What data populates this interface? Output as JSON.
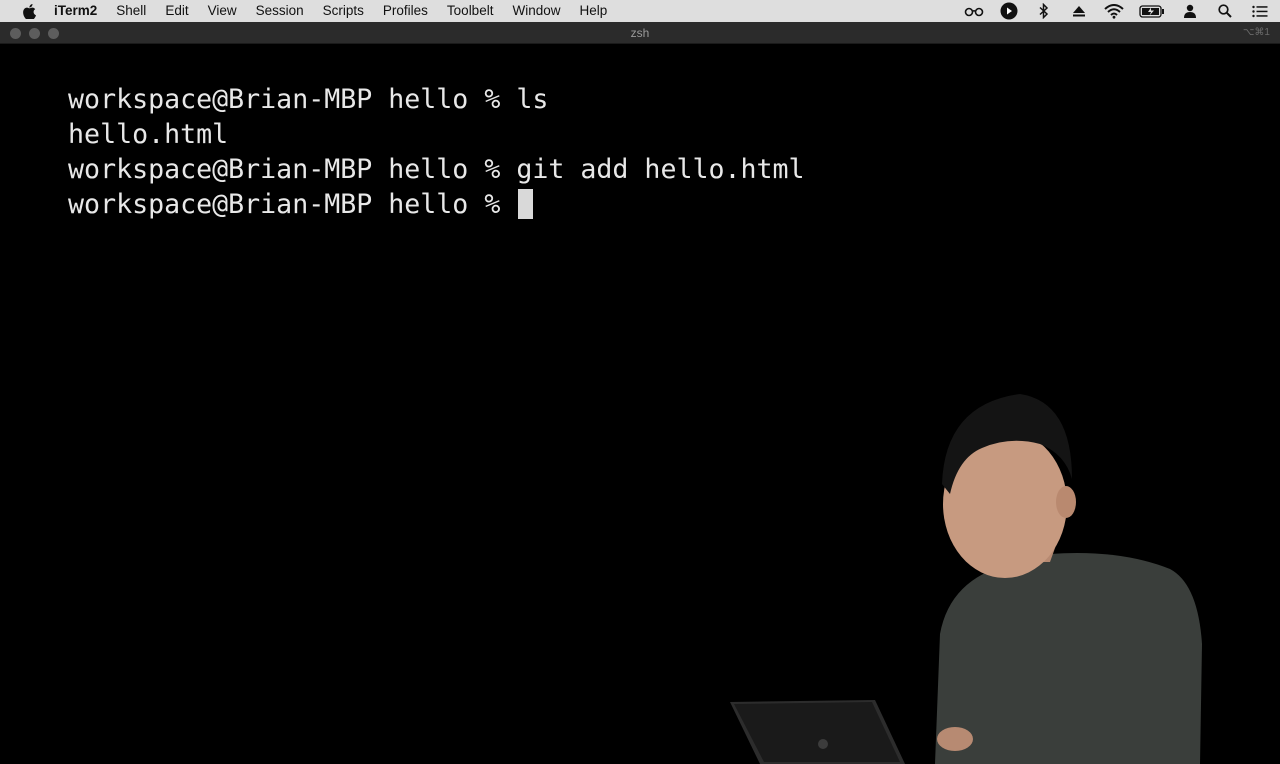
{
  "menubar": {
    "app_name": "iTerm2",
    "items": [
      "Shell",
      "Edit",
      "View",
      "Session",
      "Scripts",
      "Profiles",
      "Toolbelt",
      "Window",
      "Help"
    ],
    "status_icons": [
      "glasses-icon",
      "play-icon",
      "bluetooth-icon",
      "eject-icon",
      "wifi-icon",
      "battery-icon",
      "user-icon",
      "search-icon",
      "list-icon"
    ]
  },
  "window": {
    "title": "zsh",
    "shortcut": "⌥⌘1"
  },
  "terminal": {
    "lines": [
      "workspace@Brian-MBP hello % ls",
      "hello.html",
      "workspace@Brian-MBP hello % git add hello.html",
      "workspace@Brian-MBP hello % "
    ]
  },
  "colors": {
    "background": "#000000",
    "text": "#e8e8e8",
    "menubar": "#dedede",
    "titlebar": "#2b2b2b"
  }
}
